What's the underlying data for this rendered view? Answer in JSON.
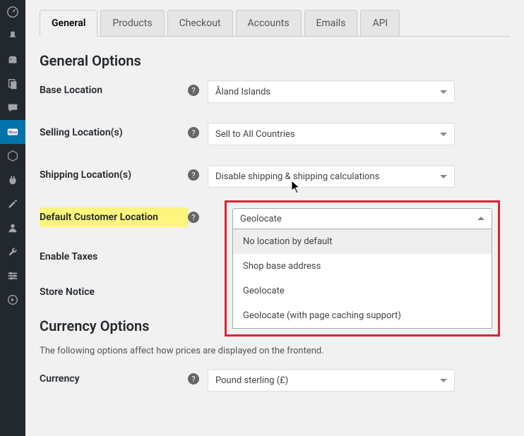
{
  "sidebar_icons": [
    "dashboard-icon",
    "pin-icon",
    "media-icon",
    "pages-icon",
    "comments-icon",
    "woocommerce-icon",
    "products-icon",
    "plugins-icon",
    "appearance-icon",
    "users-icon",
    "tools-icon",
    "settings-icon",
    "collapse-icon"
  ],
  "active_sidebar_index": 5,
  "tabs": [
    {
      "label": "General",
      "active": true
    },
    {
      "label": "Products",
      "active": false
    },
    {
      "label": "Checkout",
      "active": false
    },
    {
      "label": "Accounts",
      "active": false
    },
    {
      "label": "Emails",
      "active": false
    },
    {
      "label": "API",
      "active": false
    }
  ],
  "sections": {
    "general": {
      "heading": "General Options",
      "base_location": {
        "label": "Base Location",
        "value": "Åland Islands"
      },
      "selling_locations": {
        "label": "Selling Location(s)",
        "value": "Sell to All Countries"
      },
      "shipping_locations": {
        "label": "Shipping Location(s)",
        "value": "Disable shipping & shipping calculations"
      },
      "default_customer_location": {
        "label": "Default Customer Location",
        "value": "Geolocate",
        "options": [
          "No location by default",
          "Shop base address",
          "Geolocate",
          "Geolocate (with page caching support)"
        ]
      },
      "enable_taxes": {
        "label": "Enable Taxes"
      },
      "store_notice": {
        "label": "Store Notice"
      }
    },
    "currency": {
      "heading": "Currency Options",
      "description": "The following options affect how prices are displayed on the frontend.",
      "currency": {
        "label": "Currency",
        "value": "Pound sterling (£)"
      }
    }
  }
}
